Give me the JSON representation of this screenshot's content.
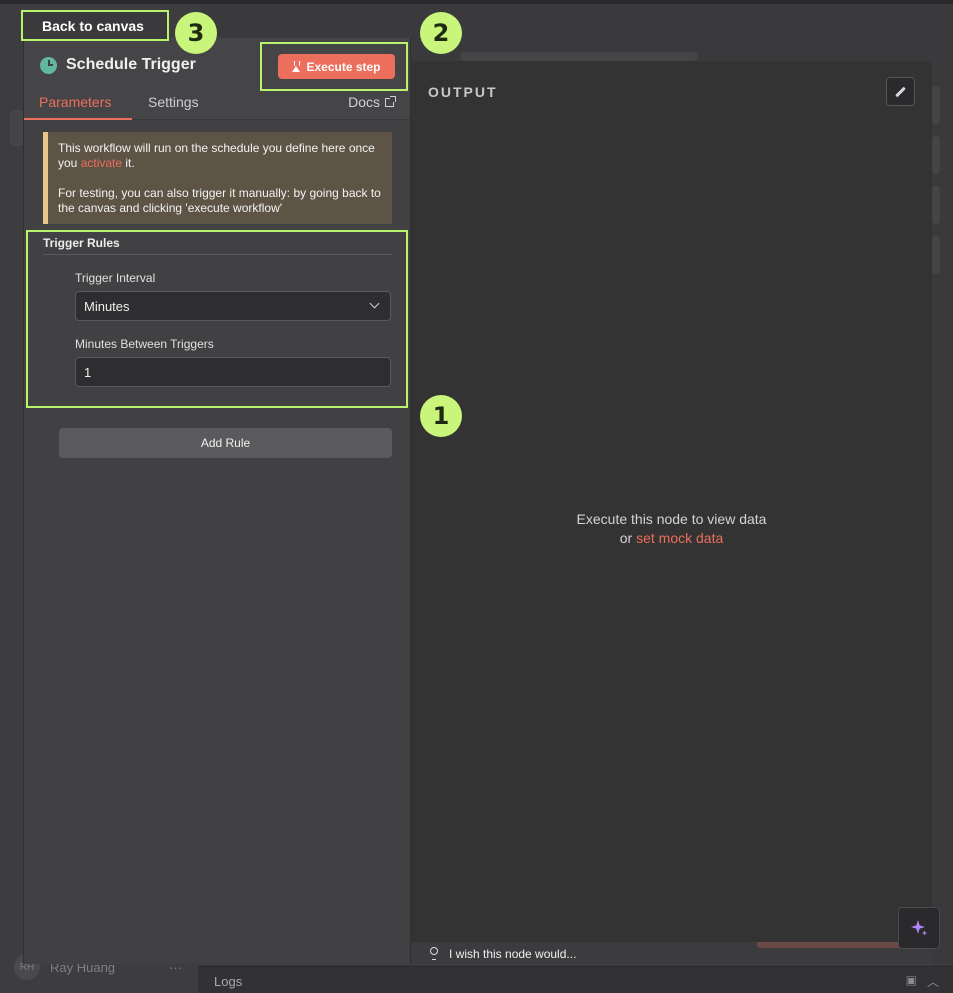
{
  "top_nav": {
    "back_label": "Back to canvas"
  },
  "node": {
    "title": "Schedule Trigger",
    "execute_label": "Execute step"
  },
  "tabs": {
    "parameters": "Parameters",
    "settings": "Settings",
    "docs": "Docs"
  },
  "notice": {
    "line1_pre": "This workflow will run on the schedule you define here once you ",
    "line1_link": "activate",
    "line1_post": " it.",
    "line2": "For testing, you can also trigger it manually: by going back to the canvas and clicking 'execute workflow'"
  },
  "trigger_rules": {
    "title": "Trigger Rules",
    "interval_label": "Trigger Interval",
    "interval_value": "Minutes",
    "between_label": "Minutes Between Triggers",
    "between_value": "1",
    "add_rule_label": "Add Rule"
  },
  "output": {
    "title": "OUTPUT",
    "empty_line1": "Execute this node to view data",
    "empty_or": "or ",
    "mock_link": "set mock data"
  },
  "feedback": {
    "wish_text": "I wish this node would..."
  },
  "footer": {
    "avatar_initials": "RH",
    "user_name": "Ray Huang",
    "more": "···",
    "logs_label": "Logs"
  },
  "annotations": {
    "badge1": "1",
    "badge2": "2",
    "badge3": "3",
    "highlight_color": "#b9f26d"
  },
  "colors": {
    "accent": "#ec6e5c",
    "trigger_icon": "#62b89f",
    "notice_border": "#e6c68a"
  }
}
